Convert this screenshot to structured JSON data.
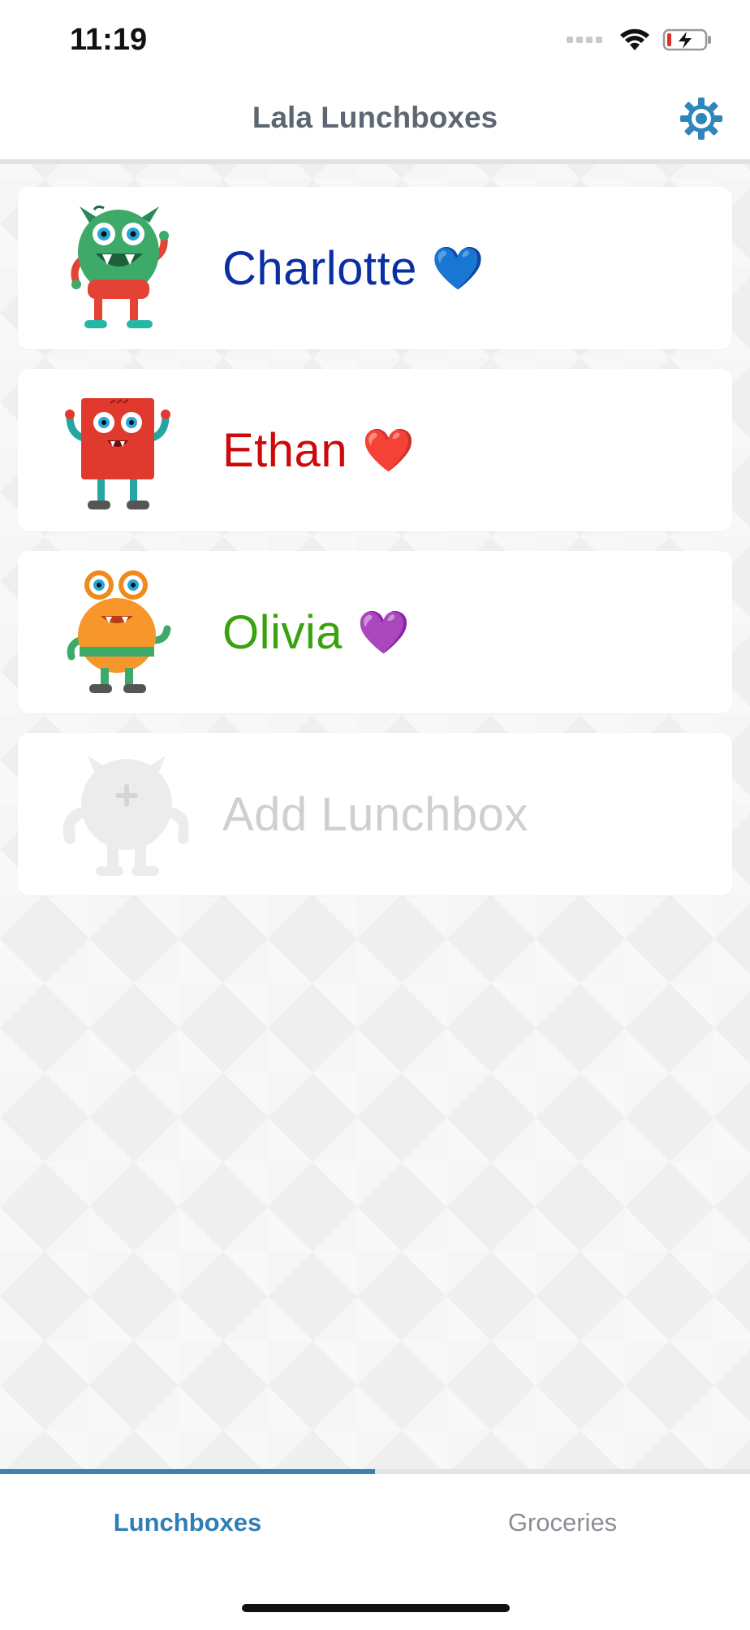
{
  "status_bar": {
    "time": "11:19",
    "icons": [
      "signal-icon",
      "wifi-icon",
      "battery-charging-icon"
    ]
  },
  "header": {
    "title": "Lala Lunchboxes",
    "settings_icon": "gear-icon"
  },
  "lunchboxes": [
    {
      "name": "Charlotte",
      "emoji": "💙",
      "color": "#0b2fa3",
      "avatar": "green-monster-icon"
    },
    {
      "name": "Ethan",
      "emoji": "❤️",
      "color": "#cc0a0a",
      "avatar": "red-square-monster-icon"
    },
    {
      "name": "Olivia",
      "emoji": "💜",
      "color": "#3aa10f",
      "avatar": "orange-monster-icon"
    }
  ],
  "add_lunchbox": {
    "label": "Add Lunchbox",
    "avatar": "placeholder-monster-icon"
  },
  "tabs": {
    "lunchboxes": "Lunchboxes",
    "groceries": "Groceries",
    "active": "lunchboxes"
  },
  "colors": {
    "accent": "#3b82b6",
    "title": "#5d6673",
    "inactive_tab": "#8a8f96"
  }
}
